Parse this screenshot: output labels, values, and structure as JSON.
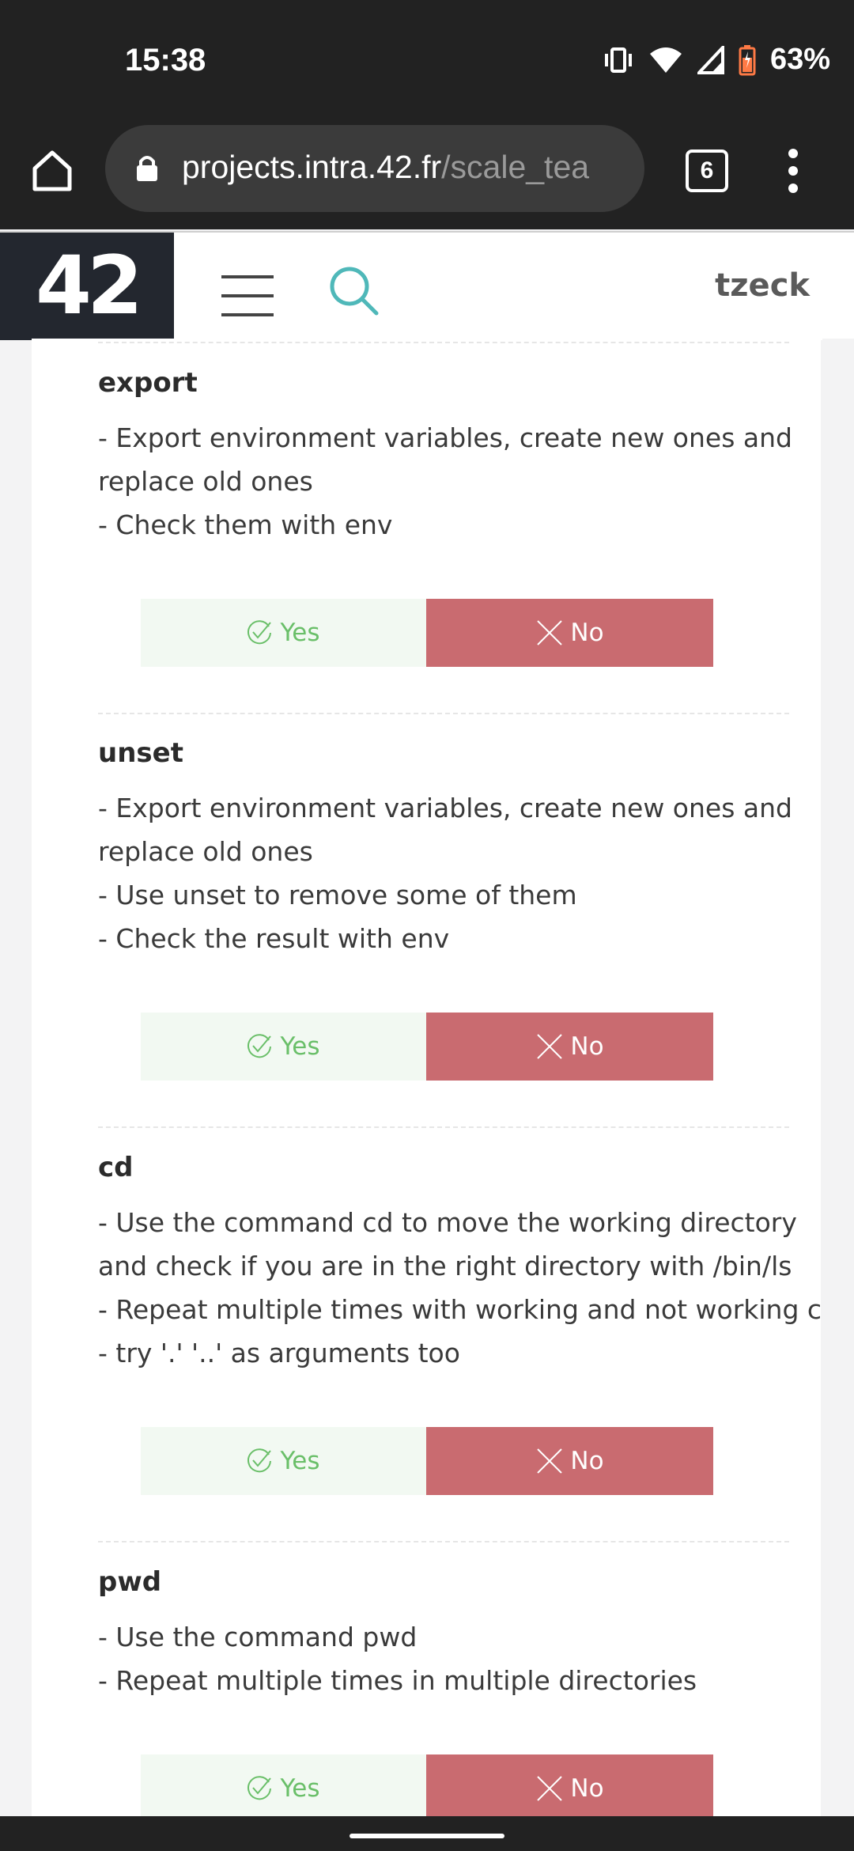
{
  "status": {
    "time": "15:38",
    "battery": "63%"
  },
  "browser": {
    "url_host": "projects.intra.42.fr",
    "url_path": "/scale_tea",
    "tab_count": "6"
  },
  "header": {
    "logo": "42",
    "username": "tzeck"
  },
  "sections": [
    {
      "title": "export",
      "lines": [
        "- Export environment variables, create new ones and",
        "replace old ones",
        "- Check them with env"
      ],
      "yes_label": "Yes",
      "no_label": "No"
    },
    {
      "title": "unset",
      "lines": [
        "- Export environment variables, create new ones and",
        "replace old ones",
        "- Use unset to remove some of them",
        "- Check the result with env"
      ],
      "yes_label": "Yes",
      "no_label": "No"
    },
    {
      "title": "cd",
      "lines": [
        "- Use the command cd to move the working directory",
        "and check if you are in the right directory with /bin/ls",
        "- Repeat multiple times with working and not working cd",
        "- try '.' '..' as arguments too"
      ],
      "yes_label": "Yes",
      "no_label": "No"
    },
    {
      "title": "pwd",
      "lines": [
        "- Use the command pwd",
        "- Repeat multiple times in multiple directories"
      ],
      "yes_label": "Yes",
      "no_label": "No"
    }
  ],
  "colors": {
    "yes_bg": "#f2f9f2",
    "yes_text": "#6abf69",
    "no_bg": "#c96b70",
    "accent_search": "#4fb8b9"
  }
}
